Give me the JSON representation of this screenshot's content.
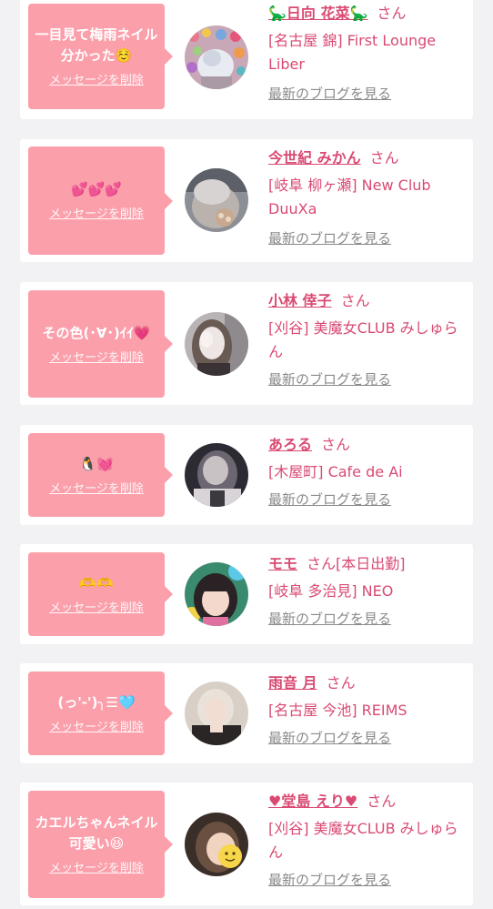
{
  "delete_label": "メッセージを削除",
  "blog_label": "最新のブログを見る",
  "san_label": "さん",
  "colors": {
    "bubble": "#fb9fab",
    "name": "#d94a72",
    "blog_link": "#8a8a8a",
    "background": "#f2f2f4"
  },
  "items": [
    {
      "message": "一目見て梅雨ネイル分かった☺️",
      "name": "🦕日向 花菜🦕",
      "status": "",
      "shop": "[名古屋 錦] First Lounge Liber"
    },
    {
      "message": "💕💕💕",
      "name": "今世紀 みかん",
      "status": "",
      "shop": "[岐阜 柳ヶ瀬] New Club DuuXa"
    },
    {
      "message": "その色(･∀･)ｲｲ💗",
      "name": "小林 倖子",
      "status": "",
      "shop": "[刈谷] 美魔女CLUB みしゅらん"
    },
    {
      "message": "🐧💓",
      "name": "あろる",
      "status": "",
      "shop": "[木屋町] Cafe de Ai"
    },
    {
      "message": "🫶🫶",
      "name": "モモ",
      "status": "[本日出勤]",
      "shop": "[岐阜 多治見] NEO"
    },
    {
      "message": "(っ'-')╮☰🩵",
      "name": "雨音 月",
      "status": "",
      "shop": "[名古屋 今池] REIMS"
    },
    {
      "message": "カエルちゃんネイル可愛い😆",
      "name": "♥堂島 えり♥",
      "status": "",
      "shop": "[刈谷] 美魔女CLUB みしゅらん"
    }
  ]
}
